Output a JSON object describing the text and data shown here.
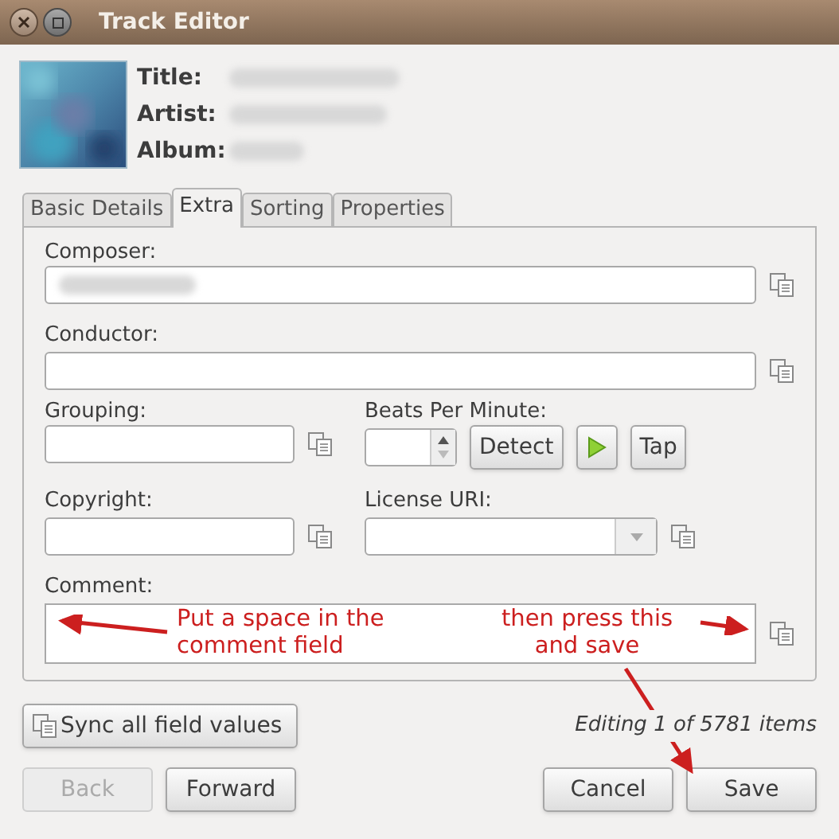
{
  "window": {
    "title": "Track Editor",
    "controls": [
      {
        "kind": "close"
      },
      {
        "kind": "maximize"
      }
    ]
  },
  "cover": {
    "kind": "picture"
  },
  "header_fields": [
    {
      "label": "Title:",
      "redacted": true
    },
    {
      "label": "Artist:",
      "redacted": true
    },
    {
      "label": "Album:",
      "redacted": true
    }
  ],
  "tabs": [
    {
      "label": "Basic Details",
      "selected": false
    },
    {
      "label": "Extra",
      "selected": true
    },
    {
      "label": "Sorting",
      "selected": false
    },
    {
      "label": "Properties",
      "selected": false
    }
  ],
  "composer": {
    "label": "Composer:",
    "redacted": true
  },
  "conductor": {
    "label": "Conductor:"
  },
  "grouping": {
    "label": "Grouping:"
  },
  "bpm": {
    "label": "Beats Per Minute:",
    "detect": "Detect",
    "tap": "Tap"
  },
  "copyright": {
    "label": "Copyright:"
  },
  "license": {
    "label": "License URI:"
  },
  "comment": {
    "label": "Comment:"
  },
  "annotations": [
    {
      "lines": [
        "Put a space in the",
        "comment field"
      ],
      "color": "#cc1f1f"
    },
    {
      "lines": [
        "then press this",
        "and save"
      ],
      "color": "#cc1f1f"
    }
  ],
  "sync_button": "Sync all field values",
  "status": "Editing 1 of 5781 items",
  "nav": [
    {
      "label": "Back",
      "disabled": true
    },
    {
      "label": "Forward",
      "disabled": false
    }
  ],
  "actions": [
    "Cancel",
    "Save"
  ]
}
